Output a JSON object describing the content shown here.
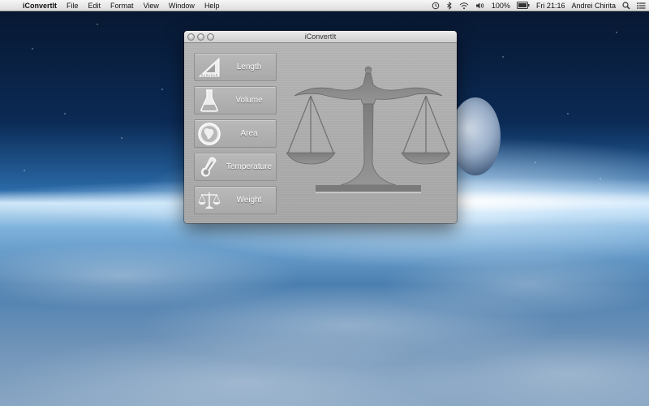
{
  "menubar": {
    "app_name": "iConvertIt",
    "menus": [
      "File",
      "Edit",
      "Format",
      "View",
      "Window",
      "Help"
    ],
    "battery": "100%",
    "clock": "Fri 21:16",
    "user": "Andrei Chirita"
  },
  "window": {
    "title": "iConvertIt",
    "buttons": [
      {
        "label": "Length",
        "icon": "ruler-triangle-icon"
      },
      {
        "label": "Volume",
        "icon": "flask-icon"
      },
      {
        "label": "Area",
        "icon": "globe-icon"
      },
      {
        "label": "Temperature",
        "icon": "thermometer-icon"
      },
      {
        "label": "Weight",
        "icon": "scale-icon"
      }
    ],
    "main_icon": "balance-scale-icon"
  }
}
